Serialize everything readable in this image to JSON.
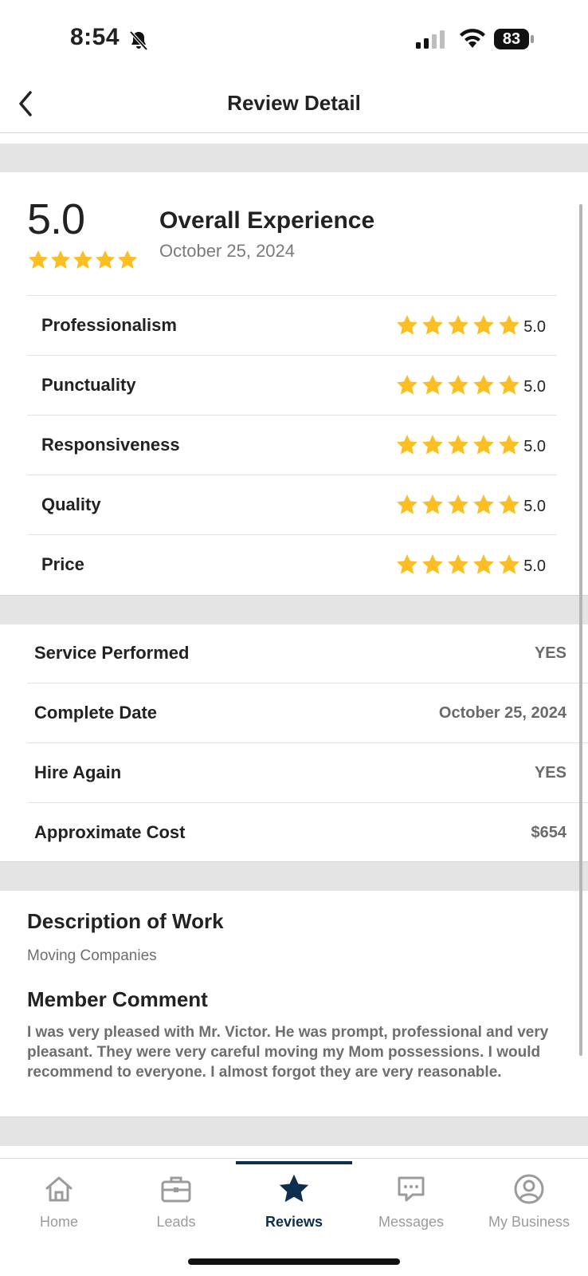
{
  "status_bar": {
    "time": "8:54",
    "battery": "83",
    "icons": [
      "bell-slash-icon",
      "signal-icon",
      "wifi-icon",
      "battery-icon"
    ]
  },
  "header": {
    "title": "Review Detail",
    "back_icon": "chevron-left-icon"
  },
  "overall": {
    "score": "5.0",
    "stars": 5,
    "title": "Overall Experience",
    "date": "October 25, 2024"
  },
  "ratings": [
    {
      "label": "Professionalism",
      "value": "5.0",
      "stars": 5
    },
    {
      "label": "Punctuality",
      "value": "5.0",
      "stars": 5
    },
    {
      "label": "Responsiveness",
      "value": "5.0",
      "stars": 5
    },
    {
      "label": "Quality",
      "value": "5.0",
      "stars": 5
    },
    {
      "label": "Price",
      "value": "5.0",
      "stars": 5
    }
  ],
  "details": [
    {
      "label": "Service Performed",
      "value": "YES"
    },
    {
      "label": "Complete Date",
      "value": "October 25, 2024"
    },
    {
      "label": "Hire Again",
      "value": "YES"
    },
    {
      "label": "Approximate Cost",
      "value": "$654"
    }
  ],
  "description": {
    "heading": "Description of Work",
    "text": "Moving Companies"
  },
  "comment": {
    "heading": "Member Comment",
    "text": "I was very pleased with Mr. Victor. He was prompt, professional and very pleasant. They were very careful moving my Mom possessions. I would recommend to everyone. I almost forgot they are very reasonable."
  },
  "nav": [
    {
      "label": "Home",
      "icon": "home-icon",
      "active": false
    },
    {
      "label": "Leads",
      "icon": "briefcase-icon",
      "active": false
    },
    {
      "label": "Reviews",
      "icon": "star-icon",
      "active": true
    },
    {
      "label": "Messages",
      "icon": "chat-icon",
      "active": false
    },
    {
      "label": "My Business",
      "icon": "user-circle-icon",
      "active": false
    }
  ],
  "colors": {
    "star": "#fbbf24",
    "nav_active": "#0e2e50",
    "band": "#e4e4e4"
  }
}
